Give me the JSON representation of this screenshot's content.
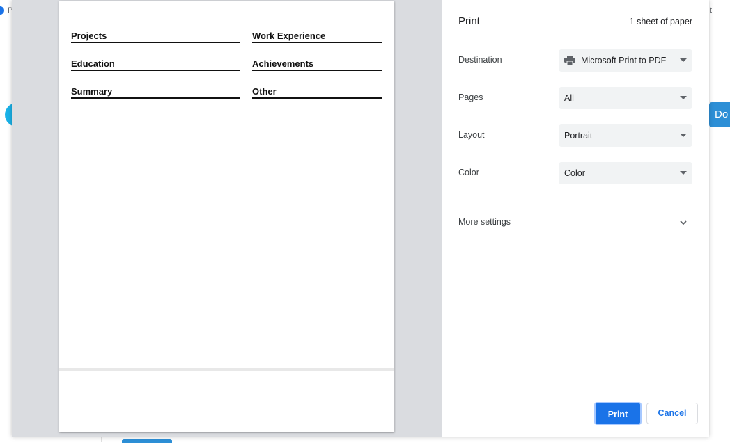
{
  "background": {
    "tab_text_left": "P",
    "tab_text_right": "t",
    "right_button_label": "Do"
  },
  "preview": {
    "sections": [
      "Projects",
      "Work Experience",
      "Education",
      "Achievements",
      "Summary",
      "Other"
    ]
  },
  "settings": {
    "title": "Print",
    "sheet_count": "1 sheet of paper",
    "destination": {
      "label": "Destination",
      "value": "Microsoft Print to PDF",
      "icon": "printer-icon"
    },
    "pages": {
      "label": "Pages",
      "value": "All"
    },
    "layout": {
      "label": "Layout",
      "value": "Portrait"
    },
    "color": {
      "label": "Color",
      "value": "Color"
    },
    "more_settings": "More settings"
  },
  "buttons": {
    "print": "Print",
    "cancel": "Cancel"
  },
  "colors": {
    "accent": "#1a73e8",
    "preview_bg": "#dadce0",
    "select_bg": "#f1f3f4"
  }
}
